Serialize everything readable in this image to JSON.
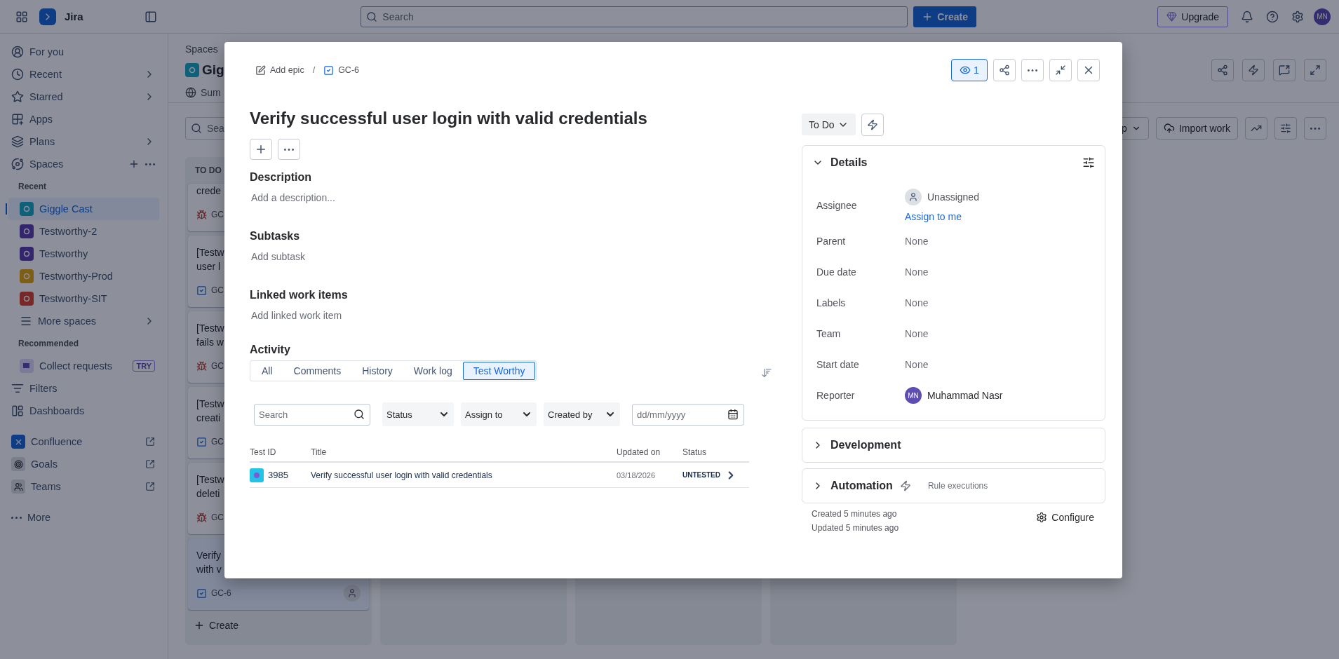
{
  "top_bar": {
    "app_name": "Jira",
    "search": {
      "placeholder": "Search"
    },
    "create_button": "Create",
    "upgrade_button": "Upgrade",
    "avatar": "MN"
  },
  "sidebar": {
    "nav": [
      {
        "label": "For you",
        "chevron": false
      },
      {
        "label": "Recent",
        "chevron": true
      },
      {
        "label": "Starred",
        "chevron": true
      },
      {
        "label": "Apps",
        "chevron": false
      },
      {
        "label": "Plans",
        "chevron": true
      }
    ],
    "spaces_label": "Spaces",
    "recent_heading": "Recent",
    "spaces": [
      {
        "label": "Giggle Cast",
        "selected": true
      },
      {
        "label": "Testworthy-2",
        "selected": false
      },
      {
        "label": "Testworthy",
        "selected": false
      },
      {
        "label": "Testworthy-Prod",
        "selected": false
      },
      {
        "label": "Testworthy-SIT",
        "selected": false
      }
    ],
    "more_spaces": "More spaces",
    "recommended_heading": "Recommended",
    "recommended": [
      {
        "label": "Collect requests",
        "badge": "TRY"
      }
    ],
    "nav2": [
      {
        "label": "Filters"
      },
      {
        "label": "Dashboards"
      }
    ],
    "apps": [
      {
        "label": "Confluence"
      },
      {
        "label": "Goals"
      },
      {
        "label": "Teams"
      }
    ],
    "more": "More"
  },
  "board": {
    "breadcrumb": "Spaces",
    "title": "Gig",
    "tab": "Sum",
    "search_placeholder": "Sea",
    "group_button": "p",
    "import_button": "Import work",
    "column": {
      "title": "TO DO",
      "create": "Create",
      "cards": [
        {
          "lines": [
            "crede"
          ],
          "kind": "bug",
          "key": "GC",
          "selected": false
        },
        {
          "lines": [
            "[Testw",
            "user l"
          ],
          "kind": "task",
          "key": "GC",
          "selected": false
        },
        {
          "lines": [
            "[Testw",
            "fails w"
          ],
          "kind": "bug",
          "key": "GC",
          "selected": false
        },
        {
          "lines": [
            "[Testw",
            "creati"
          ],
          "kind": "task",
          "key": "GC",
          "selected": false
        },
        {
          "lines": [
            "[Testw",
            "deleti"
          ],
          "kind": "bug",
          "key": "GC",
          "selected": false
        },
        {
          "lines": [
            "Verify",
            "with v"
          ],
          "kind": "task",
          "key": "GC-6",
          "selected": true,
          "avatar": true
        }
      ]
    }
  },
  "issue": {
    "breadcrumb": {
      "epic": "Add epic",
      "separator": "/",
      "key": "GC-6"
    },
    "watching": true,
    "watch_count": "1",
    "title": "Verify successful user login with valid credentials",
    "sections": [
      {
        "heading": "Description",
        "hint": "Add a description..."
      },
      {
        "heading": "Subtasks",
        "hint": "Add subtask"
      },
      {
        "heading": "Linked work items",
        "hint": "Add linked work item"
      }
    ],
    "activity": {
      "heading": "Activity",
      "tabs": [
        {
          "label": "All",
          "selected": false
        },
        {
          "label": "Comments",
          "selected": false
        },
        {
          "label": "History",
          "selected": false
        },
        {
          "label": "Work log",
          "selected": false
        },
        {
          "label": "Test Worthy",
          "selected": true
        }
      ],
      "filters": {
        "search_placeholder": "Search",
        "selects": [
          "Status",
          "Assign to",
          "Created by"
        ],
        "date_placeholder": "dd/mm/yyyy"
      },
      "table": {
        "columns": [
          "Test ID",
          "Title",
          "Updated on",
          "Status"
        ],
        "rows": [
          {
            "id": "3985",
            "title": "Verify successful user login with valid credentials",
            "updated": "03/18/2026",
            "status": "UNTESTED"
          }
        ]
      }
    },
    "status_button": "To Do",
    "details": {
      "heading": "Details",
      "expanded": true,
      "fields": [
        {
          "label": "Assignee",
          "kind": "unassigned",
          "value": "Unassigned",
          "action": "Assign to me"
        },
        {
          "label": "Parent",
          "kind": "text",
          "value": "None"
        },
        {
          "label": "Due date",
          "kind": "text",
          "value": "None"
        },
        {
          "label": "Labels",
          "kind": "text",
          "value": "None"
        },
        {
          "label": "Team",
          "kind": "text",
          "value": "None"
        },
        {
          "label": "Start date",
          "kind": "text",
          "value": "None"
        },
        {
          "label": "Reporter",
          "kind": "user",
          "value": "Muhammad Nasr",
          "initials": "MN"
        }
      ]
    },
    "panels": [
      {
        "heading": "Development",
        "expanded": false
      },
      {
        "heading": "Automation",
        "expanded": false,
        "note": "Rule executions"
      }
    ],
    "created": "Created 5 minutes ago",
    "updated": "Updated 5 minutes ago",
    "configure": "Configure"
  }
}
